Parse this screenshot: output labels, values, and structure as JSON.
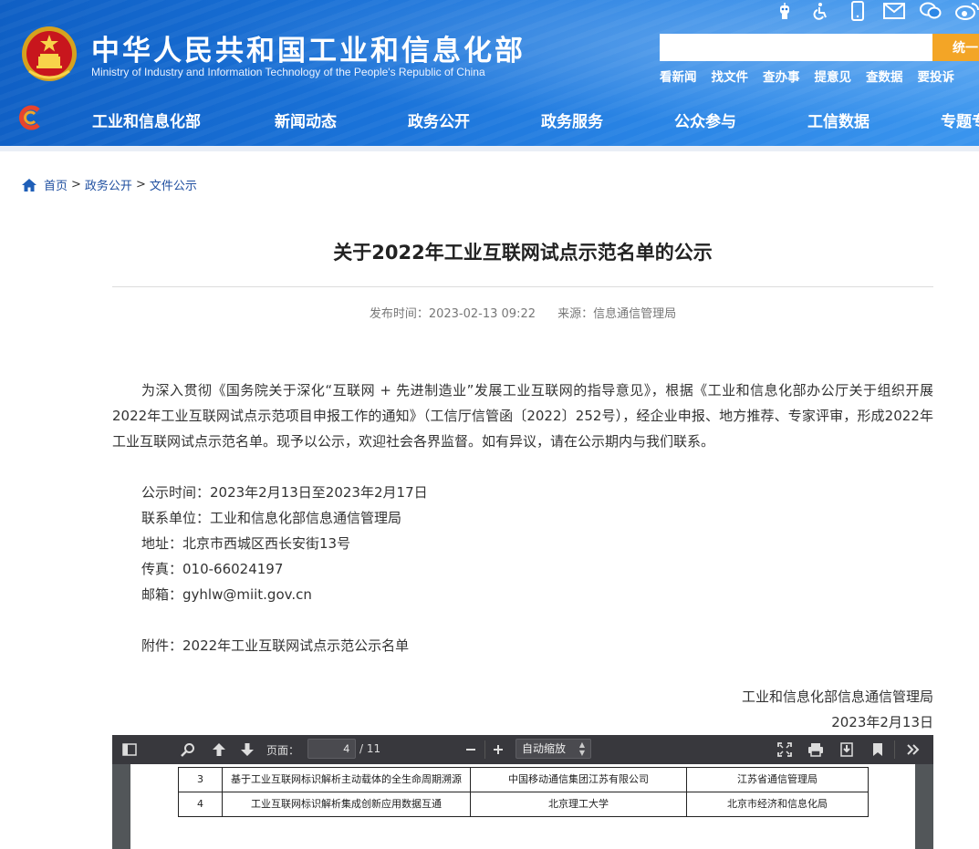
{
  "header": {
    "title_cn": "中华人民共和国工业和信息化部",
    "title_en": "Ministry of Industry and Information Technology of the People's Republic of China",
    "top_icons": [
      "robot-icon",
      "accessibility-icon",
      "mobile-icon",
      "mail-icon",
      "wechat-icon",
      "weibo-icon"
    ],
    "search": {
      "placeholder": "",
      "button_label": "统一"
    },
    "quick_links": [
      "看新闻",
      "找文件",
      "查办事",
      "提意见",
      "查数据",
      "要投诉"
    ],
    "nav": [
      "工业和信息化部",
      "新闻动态",
      "政务公开",
      "政务服务",
      "公众参与",
      "工信数据",
      "专题专"
    ],
    "colors": {
      "header_blue": "#1a73d9",
      "search_button": "#f3a526"
    }
  },
  "breadcrumb": {
    "items": [
      "首页",
      "政务公开",
      "文件公示"
    ],
    "separator": ">"
  },
  "article": {
    "title": "关于2022年工业互联网试点示范名单的公示",
    "publish_time": "发布时间：2023-02-13 09:22",
    "source": "来源：信息通信管理局",
    "paragraph": "为深入贯彻《国务院关于深化“互联网 + 先进制造业”发展工业互联网的指导意见》，根据《工业和信息化部办公厅关于组织开展2022年工业互联网试点示范项目申报工作的通知》（工信厅信管函〔2022〕252号），经企业申报、地方推荐、专家评审，形成2022年工业互联网试点示范名单。现予以公示，欢迎社会各界监督。如有异议，请在公示期内与我们联系。",
    "notice_period": "公示时间：2023年2月13日至2023年2月17日",
    "contact_unit": "联系单位：工业和信息化部信息通信管理局",
    "address": "地址：北京市西城区西长安街13号",
    "fax": "传真：010-66024197",
    "email": "邮箱：gyhlw@miit.gov.cn",
    "attachment": "附件：2022年工业互联网试点示范公示名单",
    "signature_org": "工业和信息化部信息通信管理局",
    "signature_date": "2023年2月13日"
  },
  "pdf_viewer": {
    "page_label": "页面：",
    "current_page": "4",
    "total_pages": "/ 11",
    "zoom": "自动缩放",
    "rows": [
      {
        "no": "3",
        "project": "基于工业互联网标识解析主动载体的全生命周期溯源",
        "company": "中国移动通信集团江苏有限公司",
        "recommender": "江苏省通信管理局"
      },
      {
        "no": "4",
        "project": "工业互联网标识解析集成创新应用数据互通",
        "company": "北京理工大学",
        "recommender": "北京市经济和信息化局"
      }
    ]
  }
}
